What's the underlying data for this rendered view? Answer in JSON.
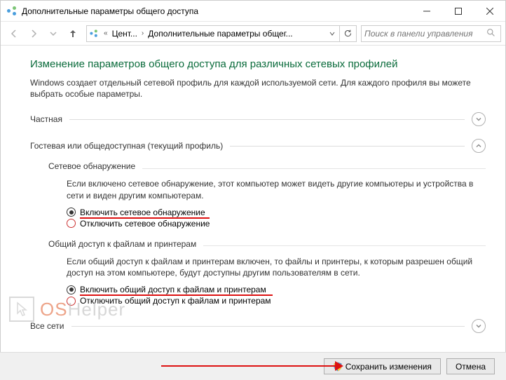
{
  "window": {
    "title": "Дополнительные параметры общего доступа"
  },
  "breadcrumb": {
    "item1": "Цент...",
    "item2": "Дополнительные параметры общег..."
  },
  "search": {
    "placeholder": "Поиск в панели управления"
  },
  "heading": "Изменение параметров общего доступа для различных сетевых профилей",
  "description": "Windows создает отдельный сетевой профиль для каждой используемой сети. Для каждого профиля вы можете выбрать особые параметры.",
  "sections": {
    "private": {
      "label": "Частная"
    },
    "guest": {
      "label": "Гостевая или общедоступная (текущий профиль)",
      "network_discovery": {
        "title": "Сетевое обнаружение",
        "desc": "Если включено сетевое обнаружение, этот компьютер может видеть другие компьютеры и устройства в сети и виден другим компьютерам.",
        "opt_on": "Включить сетевое обнаружение",
        "opt_off": "Отключить сетевое обнаружение"
      },
      "file_share": {
        "title": "Общий доступ к файлам и принтерам",
        "desc": "Если общий доступ к файлам и принтерам включен, то файлы и принтеры, к которым разрешен общий доступ на этом компьютере, будут доступны другим пользователям в сети.",
        "opt_on": "Включить общий доступ к файлам и принтерам",
        "opt_off": "Отключить общий доступ к файлам и принтерам"
      }
    },
    "all": {
      "label": "Все сети"
    }
  },
  "footer": {
    "save": "Сохранить изменения",
    "cancel": "Отмена"
  },
  "watermark": {
    "os": "OS",
    "help": "Helper"
  }
}
